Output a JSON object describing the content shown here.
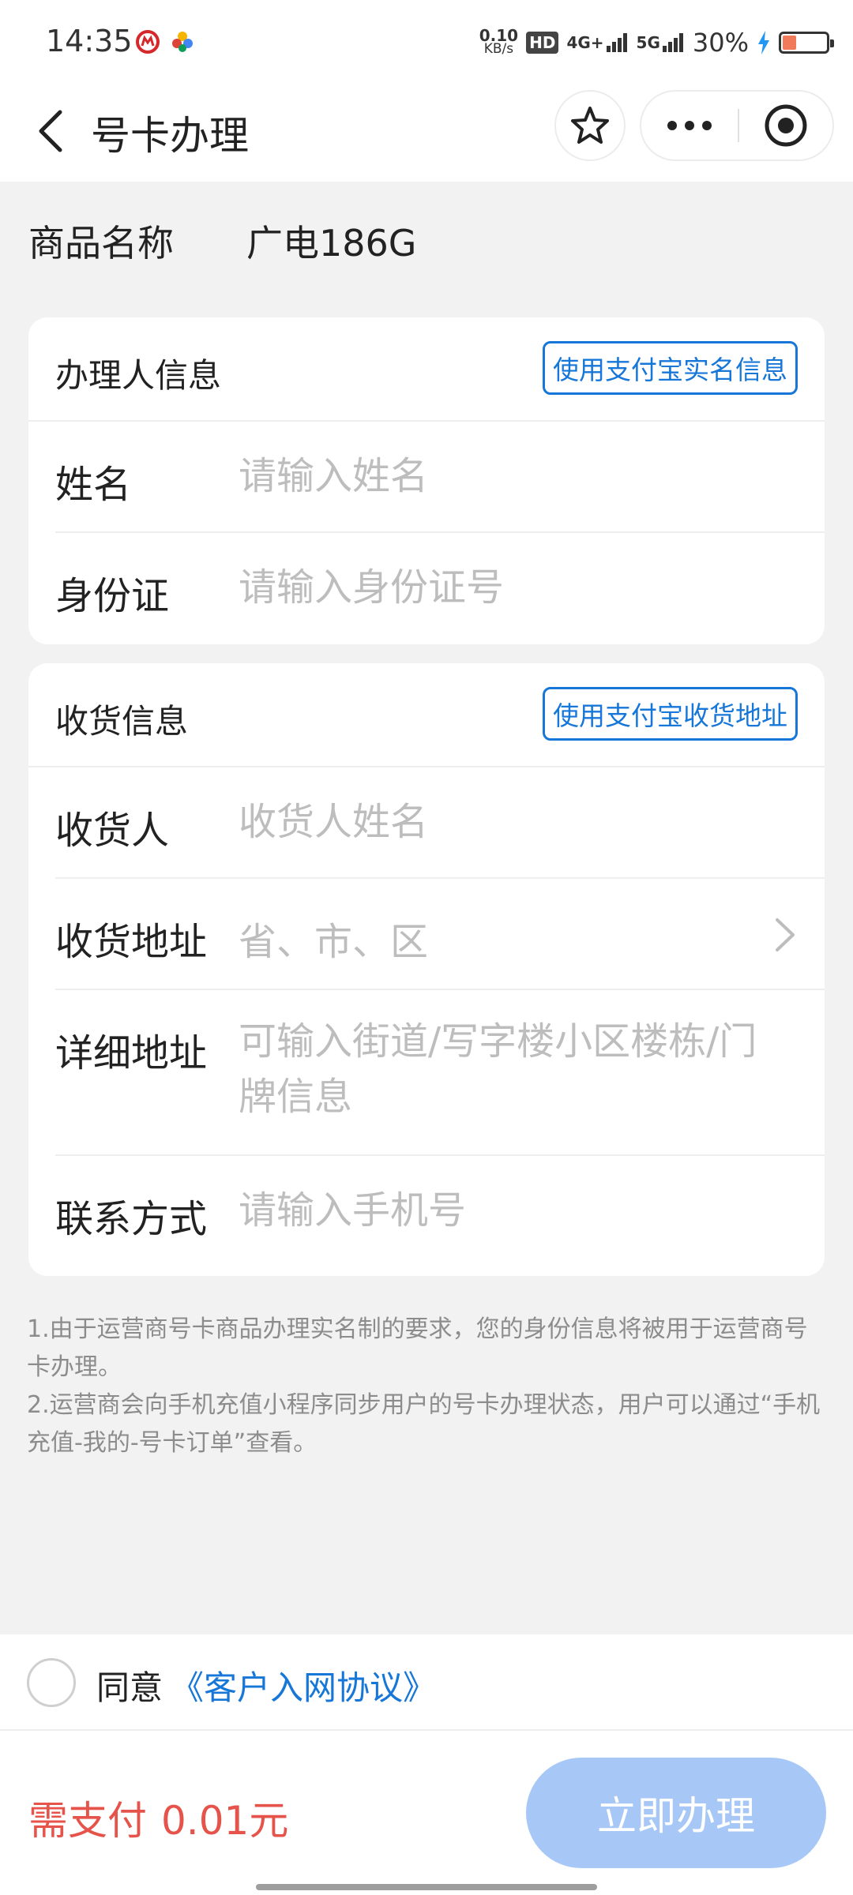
{
  "status_bar": {
    "time": "14:35",
    "net_speed_value": "0.10",
    "net_speed_unit": "KB/s",
    "hd_badge": "HD",
    "signal_4g": "4G+",
    "signal_5g": "5G",
    "battery_text": "30%",
    "battery_level": 0.3,
    "icons": [
      "app-badge-red-icon",
      "app-badge-colorful-icon",
      "hd-icon",
      "signal-icon",
      "battery-icon",
      "charging-icon"
    ]
  },
  "nav": {
    "title": "号卡办理",
    "icons": [
      "back-arrow-icon",
      "star-icon",
      "more-icon",
      "close-circle-icon"
    ]
  },
  "product": {
    "label": "商品名称",
    "value": "广电186G"
  },
  "applicant": {
    "title": "办理人信息",
    "action": "使用支付宝实名信息",
    "fields": [
      {
        "label": "姓名",
        "placeholder": "请输入姓名"
      },
      {
        "label": "身份证",
        "placeholder": "请输入身份证号"
      }
    ]
  },
  "shipping": {
    "title": "收货信息",
    "action": "使用支付宝收货地址",
    "fields": [
      {
        "label": "收货人",
        "placeholder": "收货人姓名"
      },
      {
        "label": "收货地址",
        "placeholder": "省、市、区"
      },
      {
        "label": "详细地址",
        "placeholder": "可输入街道/写字楼小区楼栋/门牌信息"
      },
      {
        "label": "联系方式",
        "placeholder": "请输入手机号"
      }
    ]
  },
  "notes": [
    "1.由于运营商号卡商品办理实名制的要求，您的身份信息将被用于运营商号卡办理。",
    "2.运营商会向手机充值小程序同步用户的号卡办理状态，用户可以通过“手机充值-我的-号卡订单”查看。"
  ],
  "agreement": {
    "prefix": "同意",
    "link": "《客户入网协议》"
  },
  "payment": {
    "label": "需支付",
    "amount": "0.01元",
    "submit": "立即办理"
  },
  "colors": {
    "accent": "#1677d8",
    "price": "#e5534b",
    "submit_disabled": "#a7c8f6",
    "background": "#f2f2f2"
  }
}
